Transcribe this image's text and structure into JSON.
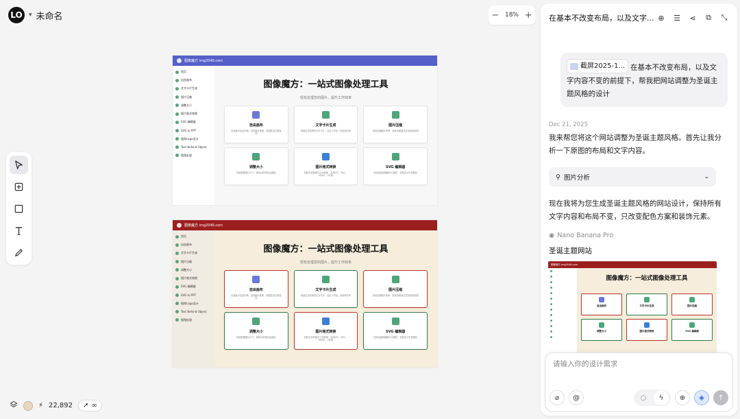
{
  "header": {
    "title": "未命名",
    "logo": "LO"
  },
  "zoom": {
    "minus": "−",
    "value": "18%",
    "plus": "+"
  },
  "tools": [
    "pointer-icon",
    "frame-icon",
    "rectangle-icon",
    "text-icon",
    "pen-icon"
  ],
  "bottom": {
    "credits": "22,892",
    "infinity": "∞"
  },
  "canvas": {
    "shot1": {
      "brand": "图像魔方 img2046.com",
      "title": "图像魔方：一站式图像处理工具",
      "subtitle": "轻松处理您的图片，提升工作效率",
      "sidebar": [
        "首页",
        "自由画布",
        "文字卡片生成",
        "图片压缩",
        "调整大小",
        "图片格式转换",
        "SVG 编辑器",
        "SVG to PPT",
        "图库Logo设计",
        "Text Behind Object",
        "图角处理"
      ],
      "cards": [
        {
          "title": "自由画布",
          "desc": "在画板中自由布局，支持图片拖拽、多图层合并和操作"
        },
        {
          "title": "文字卡片生成",
          "desc": "快速生成精美的文字卡片，自定义背景、颜色和字体"
        },
        {
          "title": "图片压缩",
          "desc": "高效压缩图片体积，保持清晰度并支持批量处理"
        },
        {
          "title": "调整大小",
          "desc": "快速调整图片尺寸，保持比例或自由裁剪"
        },
        {
          "title": "图片格式转换",
          "desc": "轻松在多种格式之间转换，支持JPG、PNG、WEBP、GIF等"
        },
        {
          "title": "SVG 编辑器",
          "desc": "在线创建和编辑SVG图形，轻松设计矢量图标"
        }
      ]
    },
    "shot2": {
      "brand": "图像魔方 img2046.com",
      "title": "图像魔方：一站式图像处理工具",
      "subtitle": "轻松处理您的图片，提升工作效率",
      "sidebar": [
        "首页",
        "自由画布",
        "文字卡片生成",
        "图片压缩",
        "调整大小",
        "图片格式转换",
        "SVG 编辑器",
        "SVG to PPT",
        "图库Logo设计",
        "Text Behind Object",
        "图角处理"
      ],
      "cards": [
        {
          "title": "自由画布",
          "desc": "在画板中自由布局，支持图片拖拽、多图层合并和操作"
        },
        {
          "title": "文字卡片生成",
          "desc": "快速生成精美的文字卡片，自定义背景、颜色和字体"
        },
        {
          "title": "图片压缩",
          "desc": "高效压缩图片体积，保持清晰度并支持批量处理"
        },
        {
          "title": "调整大小",
          "desc": "快速调整图片尺寸，保持比例或自由裁剪"
        },
        {
          "title": "图片格式转换",
          "desc": "轻松在多种格式之间转换，支持JPG、PNG、WEBP、GIF等"
        },
        {
          "title": "SVG 编辑器",
          "desc": "在线创建和编辑SVG图形，轻松设计矢量图标"
        }
      ]
    }
  },
  "panel": {
    "title": "在基本不改变布局，以及文字...",
    "user_msg": {
      "attachment": "截屏2025-1...",
      "text": "在基本不改变布局，以及文字内容不变的前提下，帮我把网站调整为圣诞主题风格的设计"
    },
    "date": "Dec 21, 2025",
    "reply1": "我来帮您将这个网站调整为圣诞主题风格。首先让我分析一下原图的布局和文字内容。",
    "analysis": "图片分析",
    "reply2": "现在我将为您生成圣诞主题风格的网站设计，保持所有文字内容和布局不变，只改变配色方案和装饰元素。",
    "model": "Nano Banana Pro",
    "result_title": "圣诞主题网站",
    "preview": {
      "brand": "图像魔方 img2046.com",
      "title": "图像魔方：一站式图像处理工具",
      "cards": [
        "自由画布",
        "文字卡片生成",
        "图片压缩",
        "调整大小",
        "图片格式转换",
        "SVG 编辑器"
      ]
    },
    "placeholder": "请输入你的设计需求"
  },
  "colors": {
    "accent": "#2a64d6",
    "xmas_red": "#9c1f1f",
    "xmas_green": "#2f7a4a",
    "original_header": "#5560c8"
  }
}
